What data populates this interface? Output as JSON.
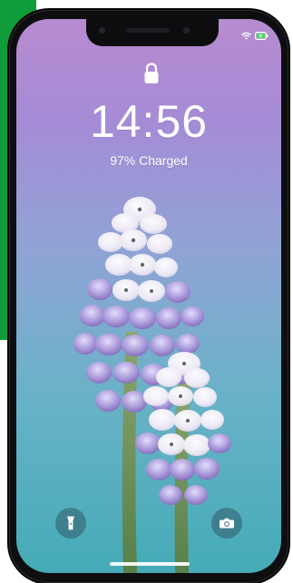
{
  "lockscreen": {
    "time": "14:56",
    "charge_status": "97% Charged"
  },
  "icons": {
    "lock": "lock-icon",
    "wifi": "wifi-icon",
    "battery": "battery-charging-icon",
    "flashlight": "flashlight-icon",
    "camera": "camera-icon"
  },
  "colors": {
    "side_accent": "#109c3a",
    "gradient_top": "#b78bd0",
    "gradient_middle": "#8fa4d5",
    "gradient_bottom": "#45abb6",
    "battery_green": "#4cd964"
  }
}
